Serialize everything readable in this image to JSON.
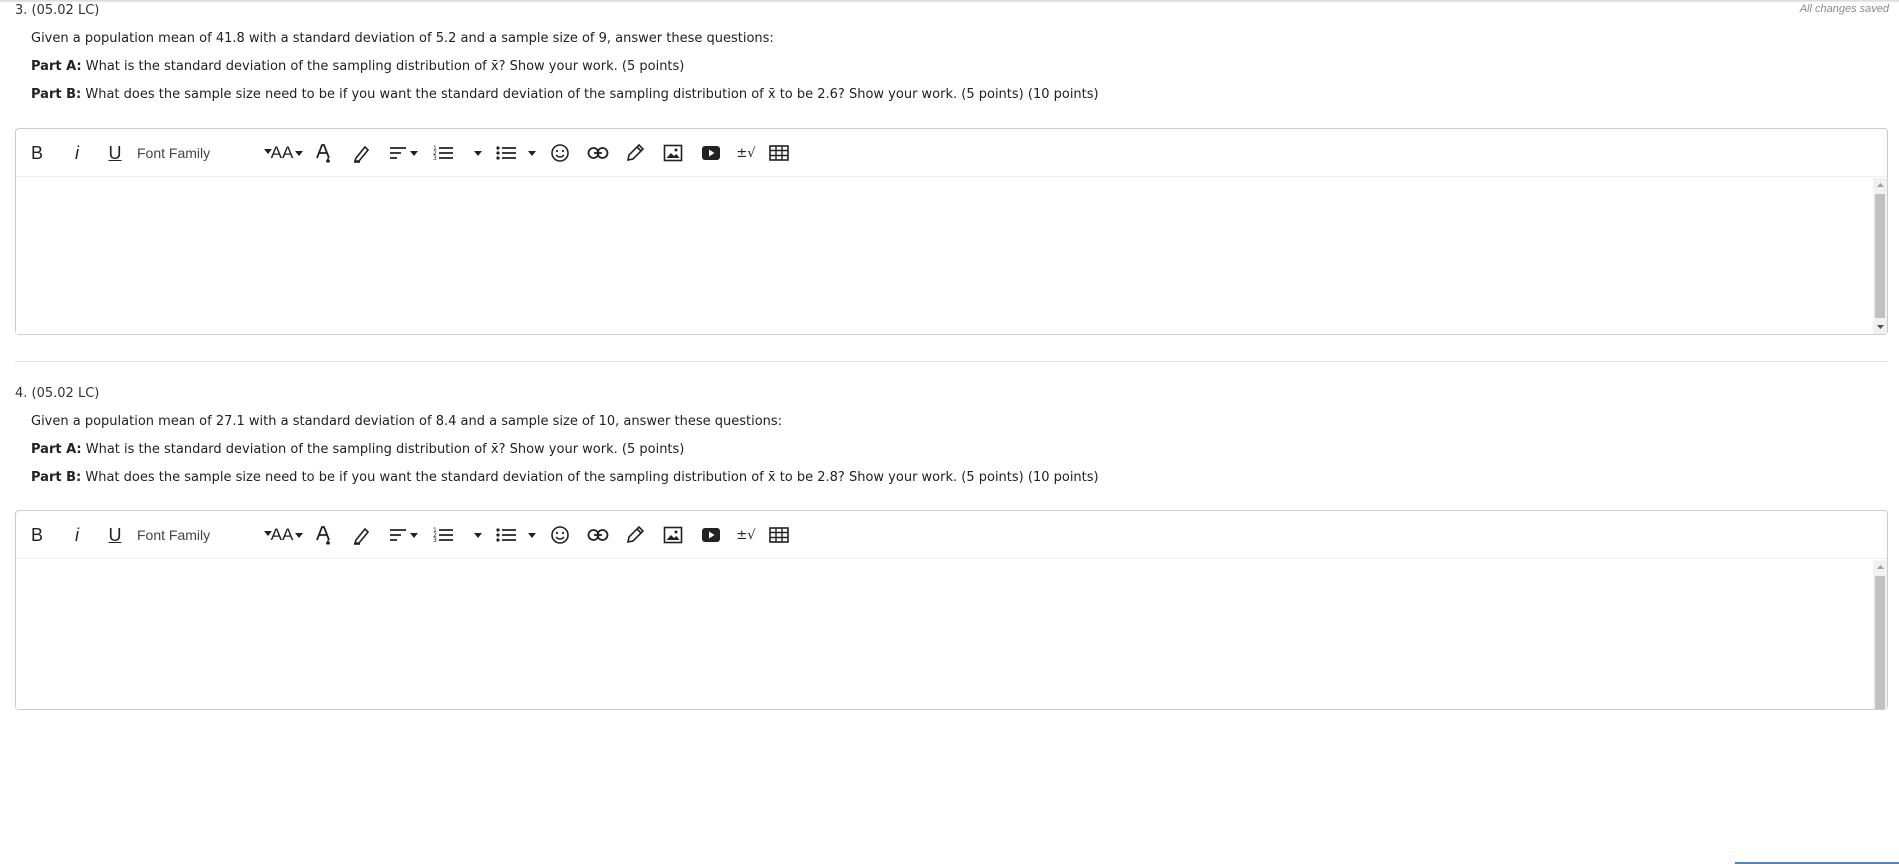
{
  "status": {
    "saved_text": "All changes saved"
  },
  "questions": [
    {
      "header": "3. (05.02 LC)",
      "intro": "Given a population mean of 41.8 with a standard deviation of 5.2 and a sample size of 9, answer these questions:",
      "part_a_label": "Part A:",
      "part_a_text": " What is the standard deviation of the sampling distribution of x̄? Show your work. (5 points)",
      "part_b_label": "Part B:",
      "part_b_text": " What does the sample size need to be if you want the standard deviation of the sampling distribution of x̄ to be 2.6? Show your work. (5 points) (10 points)"
    },
    {
      "header": "4. (05.02 LC)",
      "intro": "Given a population mean of 27.1 with a standard deviation of 8.4 and a sample size of 10, answer these questions:",
      "part_a_label": "Part A:",
      "part_a_text": " What is the standard deviation of the sampling distribution of x̄? Show your work. (5 points)",
      "part_b_label": "Part B:",
      "part_b_text": " What does the sample size need to be if you want the standard deviation of the sampling distribution of x̄ to be 2.8? Show your work. (5 points) (10 points)"
    }
  ],
  "toolbar": {
    "bold": "B",
    "italic": "i",
    "underline": "U",
    "font_family": "Font Family",
    "font_size": "AA",
    "plus_minus_sqrt": "±√",
    "icons": [
      "bold-icon",
      "italic-icon",
      "underline-icon",
      "font-family-dropdown",
      "font-size-icon",
      "text-color-icon",
      "highlight-icon",
      "align-icon",
      "ordered-list-icon",
      "unordered-list-icon",
      "emoji-icon",
      "link-icon",
      "draw-icon",
      "image-icon",
      "video-icon",
      "math-icon",
      "table-icon"
    ]
  },
  "colors": {
    "accent": "#3b8bd9",
    "border": "#cccccc",
    "scroll_thumb": "#c1c1c1"
  }
}
